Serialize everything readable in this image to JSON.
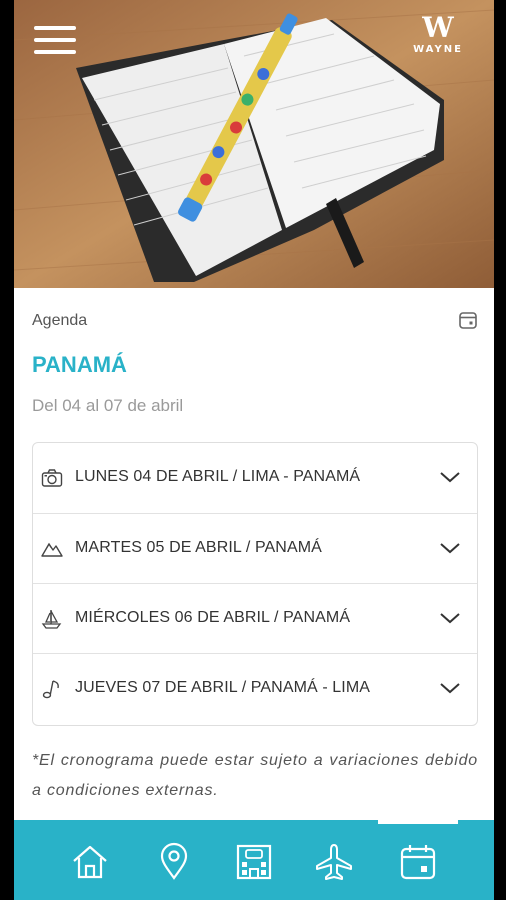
{
  "header": {
    "logo_mark": "W",
    "logo_text": "WAYNE"
  },
  "agenda": {
    "section_label": "Agenda",
    "title": "PANAMÁ",
    "dates": "Del 04 al 07 de abril",
    "items": [
      {
        "icon": "camera-icon",
        "label": "LUNES 04 DE ABRIL / LIMA - PANAMÁ"
      },
      {
        "icon": "mountains-icon",
        "label": "MARTES 05 DE ABRIL / PANAMÁ"
      },
      {
        "icon": "sailboat-icon",
        "label": "MIÉRCOLES 06 DE ABRIL / PANAMÁ"
      },
      {
        "icon": "music-note-icon",
        "label": "JUEVES 07 DE ABRIL / PANAMÁ - LIMA"
      }
    ],
    "note": "*El cronograma puede estar sujeto a variaciones debido a condiciones externas."
  },
  "tabbar": {
    "tabs": [
      "home-icon",
      "location-pin-icon",
      "hotel-icon",
      "airplane-icon",
      "calendar-icon"
    ],
    "active": "calendar-icon"
  },
  "colors": {
    "accent": "#29b2c8",
    "text": "#333333",
    "muted": "#9a9a9a"
  }
}
